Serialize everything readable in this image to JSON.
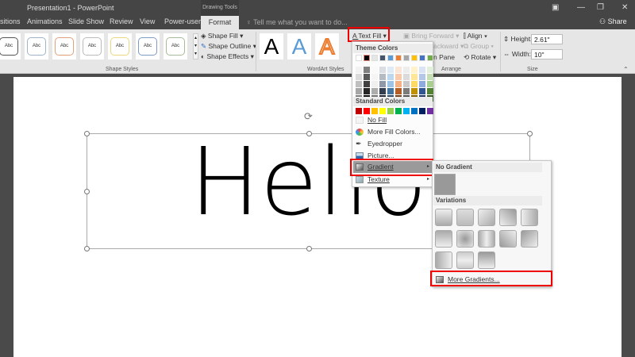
{
  "window": {
    "title": "Presentation1 - PowerPoint",
    "contextual_tab_group": "Drawing Tools",
    "share": "Share"
  },
  "tabs": [
    "sitions",
    "Animations",
    "Slide Show",
    "Review",
    "View",
    "Power-user",
    "Format"
  ],
  "tell_me": "Tell me what you want to do...",
  "ribbon": {
    "shape_styles": {
      "label": "Shape Styles",
      "thumb_text": "Abc",
      "thumb_borders": [
        "#555555",
        "#9db4cc",
        "#e0a080",
        "#bbbbbb",
        "#e8d880",
        "#7f9cc4",
        "#a8bb98"
      ],
      "shape_fill": "Shape Fill",
      "shape_outline": "Shape Outline",
      "shape_effects": "Shape Effects"
    },
    "wordart": {
      "label": "WordArt Styles",
      "samples": [
        "A",
        "A",
        "A"
      ],
      "text_fill": "Text Fill"
    },
    "arrange": {
      "label": "Arrange",
      "bring_forward": "Bring Forward",
      "send_backward": "ackward",
      "selection_pane": "n Pane",
      "align": "Align",
      "group": "Group",
      "rotate": "Rotate"
    },
    "size": {
      "label": "Size",
      "height_label": "Height:",
      "height_value": "2.61\"",
      "width_label": "Width:",
      "width_value": "10\""
    }
  },
  "slide": {
    "text": "Hello"
  },
  "text_fill_menu": {
    "theme_colors_label": "Theme Colors",
    "theme_colors": [
      "#ffffff",
      "#000000",
      "#e7e6e6",
      "#44546a",
      "#5b9bd5",
      "#ed7d31",
      "#a5a5a5",
      "#ffc000",
      "#4472c4",
      "#70ad47"
    ],
    "standard_colors_label": "Standard Colors",
    "standard_colors": [
      "#c00000",
      "#ff0000",
      "#ffc000",
      "#ffff00",
      "#92d050",
      "#00b050",
      "#00b0f0",
      "#0070c0",
      "#002060",
      "#7030a0"
    ],
    "no_fill": "No Fill",
    "more_fill_colors": "More Fill Colors...",
    "eyedropper": "Eyedropper",
    "picture": "Picture...",
    "gradient": "Gradient",
    "texture": "Texture"
  },
  "gradient_submenu": {
    "no_gradient": "No Gradient",
    "variations": "Variations",
    "variation_count": 13,
    "more_gradients": "More Gradients..."
  }
}
